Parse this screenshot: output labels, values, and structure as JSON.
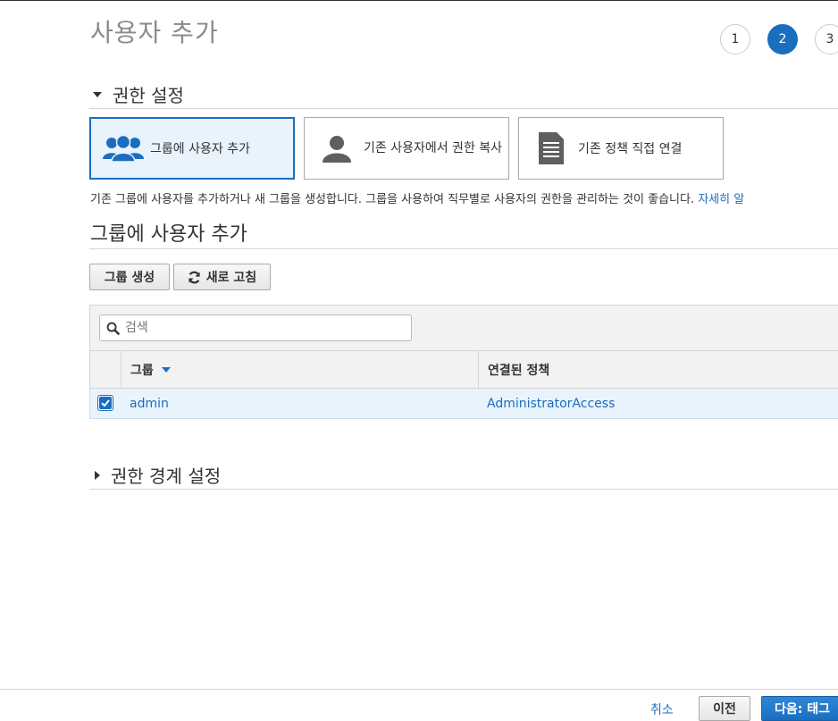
{
  "page": {
    "title": "사용자 추가"
  },
  "steps": [
    "1",
    "2",
    "3"
  ],
  "permissions": {
    "heading": "권한 설정",
    "options": [
      {
        "label": "그룹에 사용자 추가",
        "icon": "users-group-icon"
      },
      {
        "label": "기존 사용자에서 권한 복사",
        "icon": "user-icon"
      },
      {
        "label": "기존 정책 직접 연결",
        "icon": "document-icon"
      }
    ],
    "description": "기존 그룹에 사용자를 추가하거나 새 그룹을 생성합니다. 그룹을 사용하여 직무별로 사용자의 권한을 관리하는 것이 좋습니다.",
    "learn_more": "자세히 알"
  },
  "groups": {
    "heading": "그룹에 사용자 추가",
    "create_button": "그룹 생성",
    "refresh_button": "새로 고침",
    "search_placeholder": "검색",
    "columns": {
      "group": "그룹",
      "policy": "연결된 정책"
    },
    "rows": [
      {
        "checked": true,
        "group": "admin",
        "policy": "AdministratorAccess"
      }
    ]
  },
  "boundary": {
    "heading": "권한 경계 설정"
  },
  "footer": {
    "cancel": "취소",
    "previous": "이전",
    "next": "다음: 태그"
  },
  "colors": {
    "accent": "#1a6ec0",
    "selected_bg": "#e9f3fc"
  }
}
